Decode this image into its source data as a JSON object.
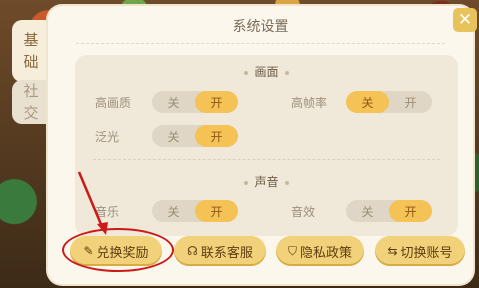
{
  "tabs": {
    "basic": [
      "基",
      "础"
    ],
    "social": [
      "社",
      "交"
    ]
  },
  "dialog": {
    "title": "系统设置",
    "close_icon": "close-icon"
  },
  "graphics": {
    "heading": "画面",
    "options": [
      {
        "label": "高画质",
        "off": "关",
        "on": "开",
        "state": "on"
      },
      {
        "label": "高帧率",
        "off": "关",
        "on": "开",
        "state": "off"
      },
      {
        "label": "泛光",
        "off": "关",
        "on": "开",
        "state": "on"
      }
    ]
  },
  "sound": {
    "heading": "声音",
    "options": [
      {
        "label": "音乐",
        "off": "关",
        "on": "开",
        "state": "on"
      },
      {
        "label": "音效",
        "off": "关",
        "on": "开",
        "state": "on"
      }
    ]
  },
  "buttons": {
    "redeem": "兑换奖励",
    "support": "联系客服",
    "privacy": "隐私政策",
    "switch_account": "切换账号"
  },
  "colors": {
    "accent": "#f4c255",
    "annotation": "#cc1a18"
  }
}
